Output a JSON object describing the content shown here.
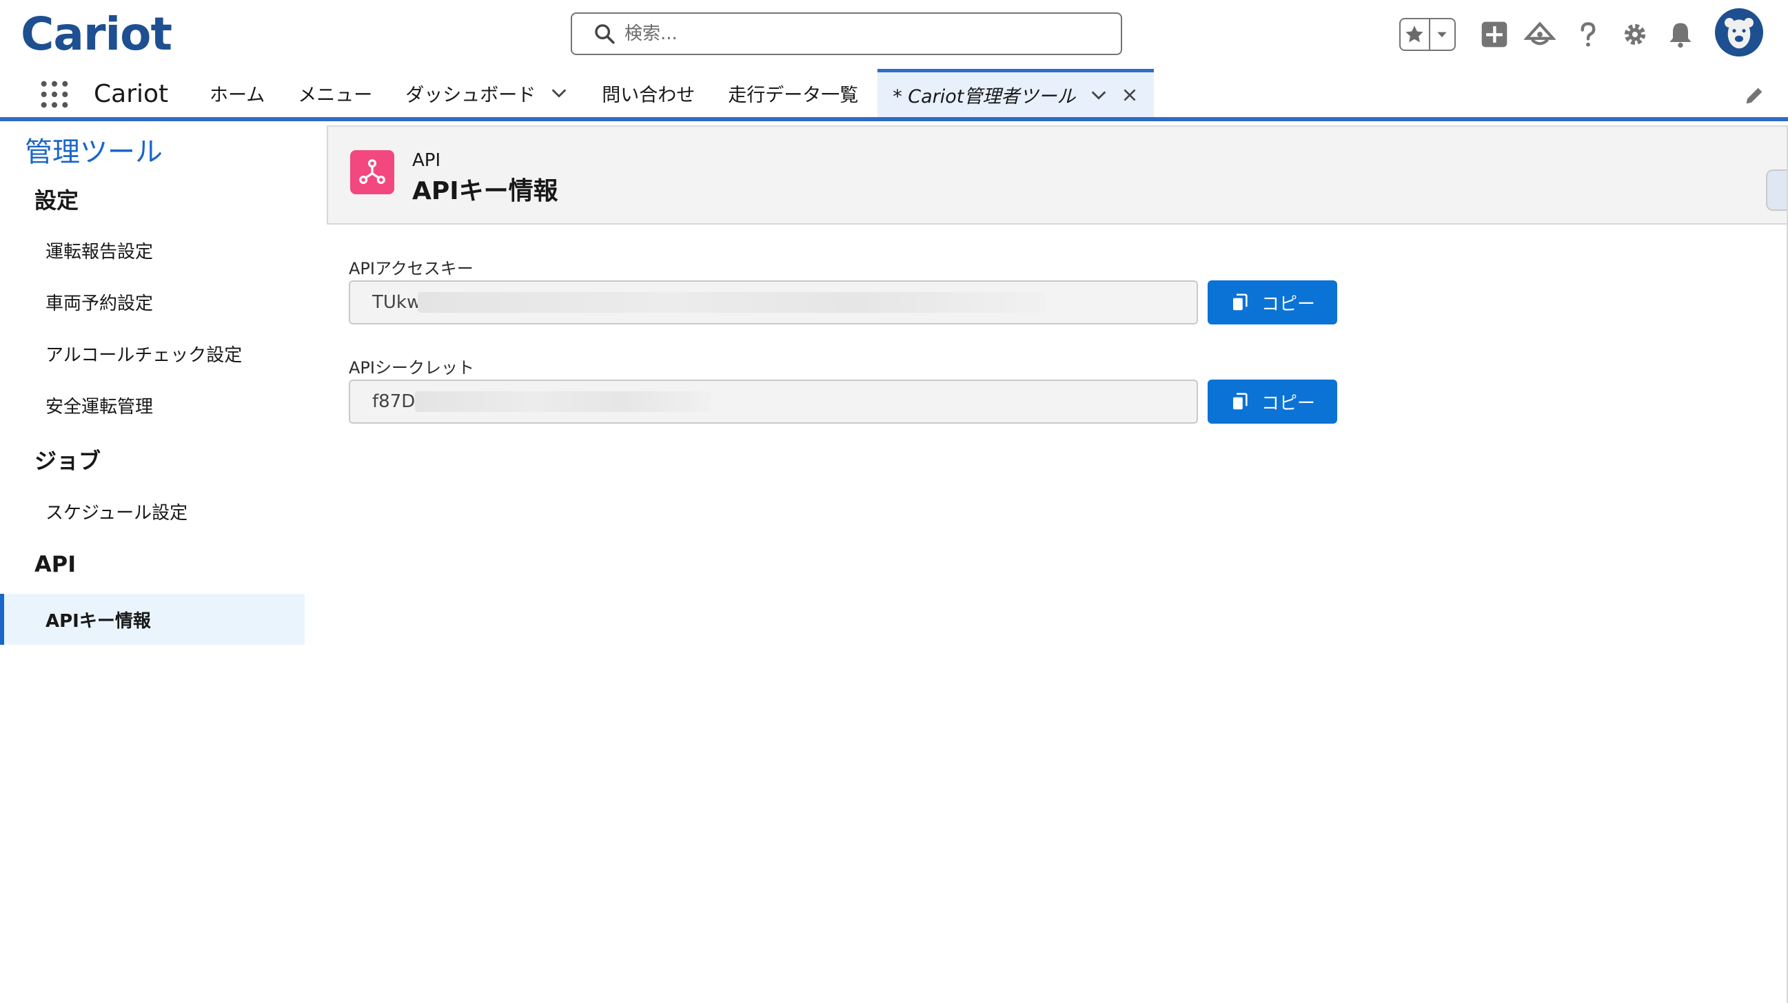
{
  "header": {
    "logo_text": "Cariot",
    "search_placeholder": "検索...",
    "icons": [
      "star-icon",
      "chevron-down-icon",
      "plus-icon",
      "trailhead-icon",
      "help-icon",
      "gear-icon",
      "bell-icon",
      "avatar-bear-icon"
    ]
  },
  "nav": {
    "app_name": "Cariot",
    "items": [
      {
        "label": "ホーム"
      },
      {
        "label": "メニュー"
      },
      {
        "label": "ダッシュボード"
      },
      {
        "label": "問い合わせ"
      },
      {
        "label": "走行データ一覧"
      }
    ],
    "active_tab": "* Cariot管理者ツール"
  },
  "sidebar": {
    "title": "管理ツール",
    "sections": [
      {
        "heading": "設定",
        "items": [
          "運転報告設定",
          "車両予約設定",
          "アルコールチェック設定",
          "安全運転管理"
        ]
      },
      {
        "heading": "ジョブ",
        "items": [
          "スケジュール設定"
        ]
      },
      {
        "heading": "API",
        "items": [
          "APIキー情報"
        ]
      }
    ],
    "selected_item": "APIキー情報"
  },
  "page": {
    "eyebrow": "API",
    "title": "APIキー情報",
    "fields": [
      {
        "label": "APIアクセスキー",
        "value": "TUkw",
        "button": "コピー"
      },
      {
        "label": "APIシークレット",
        "value": "f87D",
        "button": "コピー"
      }
    ]
  },
  "colors": {
    "brand_blue": "#1b66c9",
    "button_blue": "#0b73d6",
    "page_icon_pink": "#f2477f",
    "nav_underline": "#2e6cc4"
  }
}
